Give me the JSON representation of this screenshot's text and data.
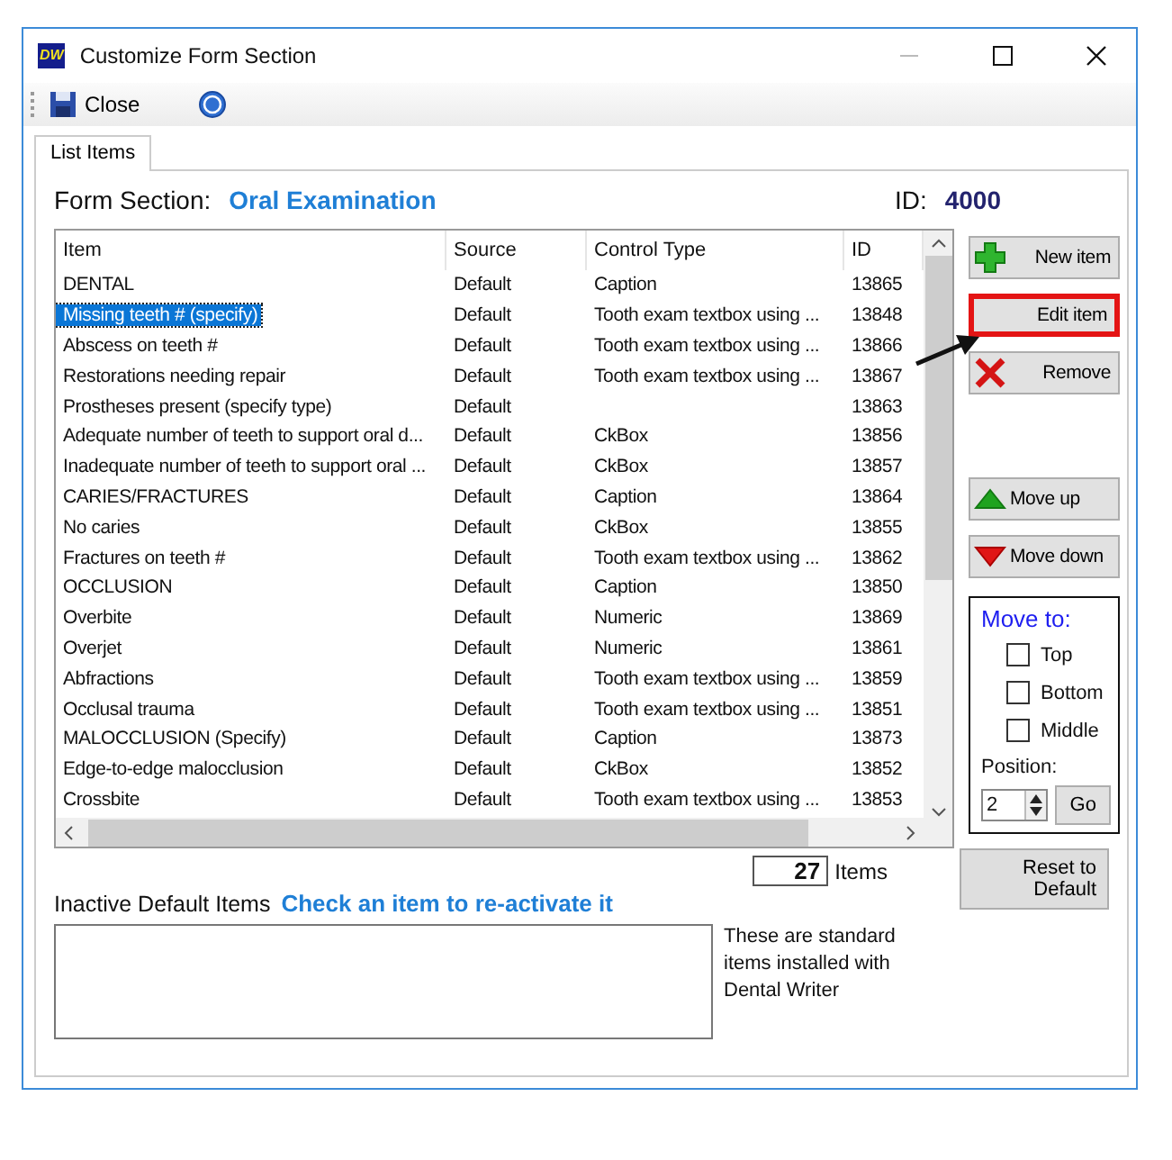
{
  "window": {
    "title": "Customize Form Section",
    "app_icon": "DW"
  },
  "toolbar": {
    "close_label": "Close"
  },
  "tabs": [
    {
      "label": "List Items",
      "selected": true
    }
  ],
  "form_section": {
    "label": "Form Section:",
    "value": "Oral Examination",
    "id_label": "ID:",
    "id_value": "4000"
  },
  "table": {
    "columns": [
      "Item",
      "Source",
      "Control Type",
      "ID"
    ],
    "rows": [
      {
        "cells": [
          "DENTAL",
          "Default",
          "Caption",
          "13865"
        ],
        "selected": false
      },
      {
        "cells": [
          "Missing teeth # (specify)",
          "Default",
          "Tooth exam textbox using ...",
          "13848"
        ],
        "selected": true
      },
      {
        "cells": [
          "Abscess on teeth #",
          "Default",
          "Tooth exam textbox using ...",
          "13866"
        ],
        "selected": false
      },
      {
        "cells": [
          "Restorations needing repair",
          "Default",
          "Tooth exam textbox using ...",
          "13867"
        ],
        "selected": false
      },
      {
        "cells": [
          "Prostheses present (specify type)",
          "Default",
          "",
          "13863"
        ],
        "selected": false
      },
      {
        "cells": [
          "Adequate number of teeth to support oral d...",
          "Default",
          "CkBox",
          "13856"
        ],
        "selected": false
      },
      {
        "cells": [
          "Inadequate number of teeth to support oral ...",
          "Default",
          "CkBox",
          "13857"
        ],
        "selected": false
      },
      {
        "cells": [
          "CARIES/FRACTURES",
          "Default",
          "Caption",
          "13864"
        ],
        "selected": false
      },
      {
        "cells": [
          "No caries",
          "Default",
          "CkBox",
          "13855"
        ],
        "selected": false
      },
      {
        "cells": [
          "Fractures on teeth #",
          "Default",
          "Tooth exam textbox using ...",
          "13862"
        ],
        "selected": false
      },
      {
        "cells": [
          "OCCLUSION",
          "Default",
          "Caption",
          "13850"
        ],
        "selected": false
      },
      {
        "cells": [
          "Overbite",
          "Default",
          "Numeric",
          "13869"
        ],
        "selected": false
      },
      {
        "cells": [
          "Overjet",
          "Default",
          "Numeric",
          "13861"
        ],
        "selected": false
      },
      {
        "cells": [
          "Abfractions",
          "Default",
          "Tooth exam textbox using ...",
          "13859"
        ],
        "selected": false
      },
      {
        "cells": [
          "Occlusal trauma",
          "Default",
          "Tooth exam textbox using ...",
          "13851"
        ],
        "selected": false
      },
      {
        "cells": [
          "MALOCCLUSION (Specify)",
          "Default",
          "Caption",
          "13873"
        ],
        "selected": false
      },
      {
        "cells": [
          "Edge-to-edge malocclusion",
          "Default",
          "CkBox",
          "13852"
        ],
        "selected": false
      },
      {
        "cells": [
          "Crossbite",
          "Default",
          "Tooth exam textbox using ...",
          "13853"
        ],
        "selected": false
      }
    ]
  },
  "buttons": [
    {
      "label": "New item",
      "kind": "plus",
      "highlighted": false
    },
    {
      "label": "Edit item",
      "kind": "none",
      "highlighted": true
    },
    {
      "label": "Remove",
      "kind": "cross",
      "highlighted": false
    },
    {
      "label": "Move up",
      "kind": "up",
      "highlighted": false
    },
    {
      "label": "Move down",
      "kind": "down",
      "highlighted": false
    }
  ],
  "move_to": {
    "title": "Move to:",
    "options": [
      {
        "label": "Top",
        "checked": false
      },
      {
        "label": "Bottom",
        "checked": false
      },
      {
        "label": "Middle",
        "checked": false
      }
    ],
    "position_label": "Position:",
    "position_value": "2",
    "go_label": "Go"
  },
  "count": {
    "value": "27",
    "label": "Items"
  },
  "reset_button": "Reset to Default",
  "inactive": {
    "label": "Inactive Default Items",
    "hint": "Check an item to re-activate it",
    "note": "These are standard items installed with Dental Writer"
  }
}
